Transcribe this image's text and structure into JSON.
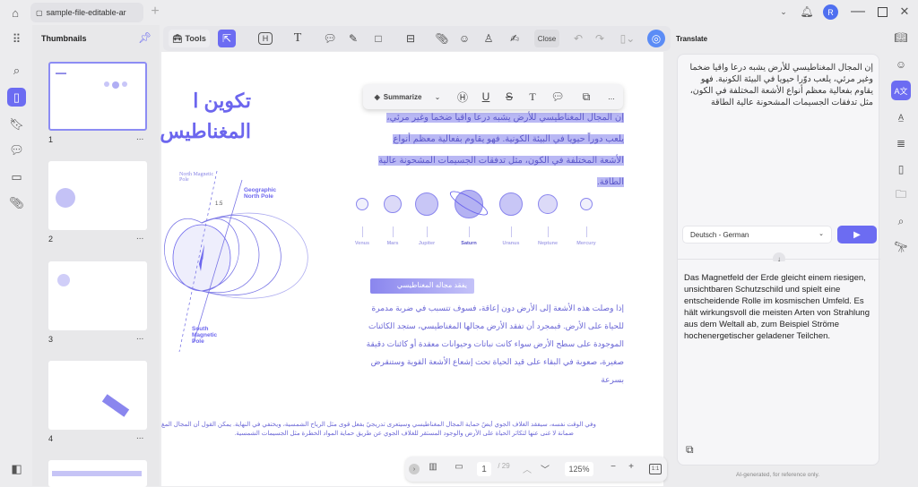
{
  "window": {
    "tab_title": "sample-file-editable-ar",
    "avatar_initial": "R"
  },
  "thumbnails": {
    "title": "Thumbnails",
    "pages": [
      "1",
      "2",
      "3",
      "4"
    ],
    "more": "..."
  },
  "toolbar": {
    "tools_label": "Tools",
    "close_label": "Close"
  },
  "floating_toolbar": {
    "summarize_label": "Summarize",
    "more": "..."
  },
  "document": {
    "title_lines": [
      "تكوين ا",
      "المغناطيس"
    ],
    "intro_lines": [
      "إن المجال المغناطيسي للأرض يشبه درعا واقيا ضخما وغير مرئي،",
      "يلعب دوراً حيويا في البيئة الكونية. فهو يقاوم بفعالية معظم أنواع",
      "الأشعة المختلفة في الكون، مثل تدفقات الجسيمات المشحونة عالية",
      "الطاقة."
    ],
    "diagram": {
      "north_magnetic": "North Magnetic Pole",
      "geographic_north": "Geographic North Pole",
      "south_magnetic": "South Magnetic Pole",
      "angle": "1.5"
    },
    "planets": [
      "Venus",
      "Mars",
      "Jupiter",
      "Saturn",
      "Uranus",
      "Neptune",
      "Mercury"
    ],
    "section_heading": "يفقد مجاله المغناطيسي",
    "section_lines": [
      "إذا وصلت هذه الأشعة إلى الأرض دون إعاقة، فسوف تتسبب في ضربة مدمرة",
      "للحياة على الأرض. فبمجرد أن تفقد الأرض مجالها المغناطيسي، ستجد الكائنات",
      "الموجودة على سطح الأرض سواء كانت نباتات وحيوانات معقدة أو كائنات دقيقة",
      "صغيرة، صعوبة في البقاء على قيد الحياة تحت إشعاع الأشعة القوية وستنقرض",
      "بسرعة"
    ],
    "footer_lines": [
      "وفي الوقت نفسه، سيفقد الغلاف الجوي أيضً حماية المجال المغناطيسي وسيتعرى تدريجيً بفعل قوى مثل الرياح الشمسية، ويختفي في النهاية. يمكن القول أن المجال المغ",
      "ضمانة لا غنى عنها لتكاثر الحياة على الأرض والوجود المستقر للغلاف الجوي عن طريق حماية المواد الخطرة مثل الجسيمات الشمسية."
    ]
  },
  "page_nav": {
    "current_page": "1",
    "total": "/ 29",
    "zoom": "125%"
  },
  "translate": {
    "title": "Translate",
    "source_text": "إن المجال المغناطيسي للأرض يشبه درعا واقيا ضخما وغير مرئي، يلعب دوّرا حيويا في البيئة الكونية. فهو يقاوم بفعالية معظم أنواع الأشعة المختلفة في الكون، مثل تدفقات الجسيمات المشحونة عالية الطاقة",
    "target_language": "Deutsch - German",
    "result_text": "Das Magnetfeld der Erde gleicht einem riesigen, unsichtbaren Schutzschild und spielt eine entscheidende Rolle im kosmischen Umfeld. Es hält wirkungsvoll die meisten Arten von Strahlung aus dem Weltall ab, zum Beispiel Ströme hochenergetischer geladener Teilchen.",
    "disclaimer": "AI-generated, for reference only."
  },
  "colors": {
    "accent": "#6c6cf2",
    "doc_text": "#6a66d6",
    "selection": "#b9b8f4"
  }
}
